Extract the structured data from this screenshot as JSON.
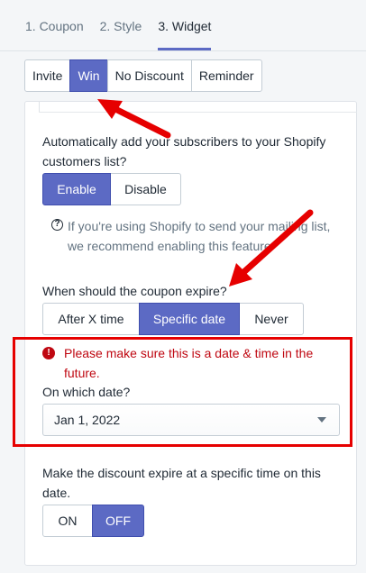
{
  "tabs": [
    {
      "label": "1. Coupon"
    },
    {
      "label": "2. Style"
    },
    {
      "label": "3. Widget"
    }
  ],
  "active_tab": "3. Widget",
  "subtabs": [
    {
      "label": "Invite"
    },
    {
      "label": "Win"
    },
    {
      "label": "No Discount"
    },
    {
      "label": "Reminder"
    }
  ],
  "active_subtab": "Win",
  "shopify": {
    "question_line1": "Automatically add your subscribers to your Shopify",
    "question_line2": "customers list?",
    "enable_label": "Enable",
    "disable_label": "Disable",
    "selected": "Enable",
    "help_line1": "If you're using Shopify to send your mailing list,",
    "help_line2": "we recommend enabling this feature"
  },
  "expiry": {
    "question": "When should the coupon expire?",
    "options": [
      {
        "label": "After X time"
      },
      {
        "label": "Specific date"
      },
      {
        "label": "Never"
      }
    ],
    "selected": "Specific date"
  },
  "date": {
    "error_line1": "Please make sure this is a date & time in the",
    "error_line2": "future.",
    "label": "On which date?",
    "value": "Jan 1, 2022"
  },
  "time": {
    "question_line1": "Make the discount expire at a specific time on this",
    "question_line2": "date.",
    "on_label": "ON",
    "off_label": "OFF",
    "selected": "OFF"
  },
  "colors": {
    "accent": "#5c6ac4",
    "error": "#bf0711",
    "annotation_red": "#e60000"
  },
  "icons": {
    "help": "question-circle-icon",
    "error": "alert-circle-icon",
    "select": "caret-down-icon"
  }
}
